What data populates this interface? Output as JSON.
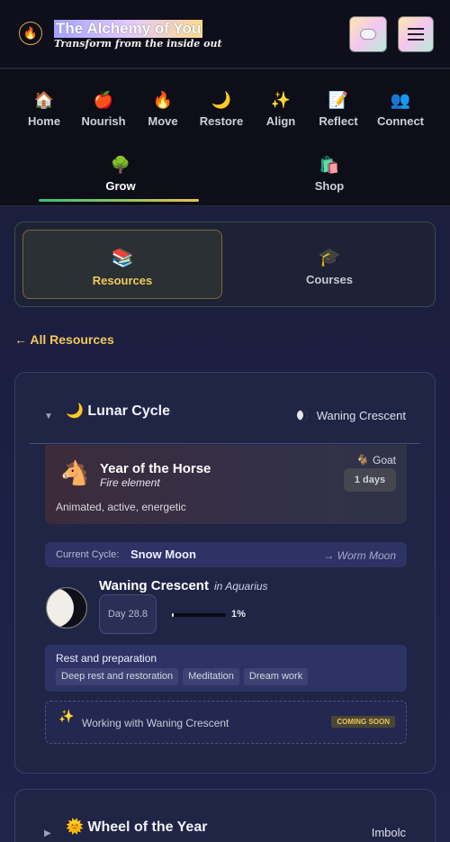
{
  "header": {
    "logo_icon": "flame-in-circle-icon",
    "brand_title": "The Alchemy of You",
    "brand_tagline": "Transform from the inside out",
    "chat_button_icon": "chat-bubble-icon",
    "menu_button_icon": "hamburger-menu-icon"
  },
  "nav": {
    "items": [
      {
        "label": "Home",
        "icon": "🏠"
      },
      {
        "label": "Nourish",
        "icon": "🍎"
      },
      {
        "label": "Move",
        "icon": "🔥"
      },
      {
        "label": "Restore",
        "icon": "🌙"
      },
      {
        "label": "Align",
        "icon": "✨"
      },
      {
        "label": "Reflect",
        "icon": "📝"
      },
      {
        "label": "Connect",
        "icon": "👥"
      },
      {
        "label": "Grow",
        "icon": "🌳"
      },
      {
        "label": "Shop",
        "icon": "🛍️"
      }
    ],
    "active": "Grow"
  },
  "subtabs": {
    "resources": {
      "label": "Resources",
      "icon": "📚"
    },
    "courses": {
      "label": "Courses",
      "icon": "🎓"
    },
    "active": "Resources"
  },
  "back_link": "← All Resources",
  "lunar": {
    "title": "Lunar Cycle",
    "title_icon": "🌙",
    "phase_name": "Waning Crescent",
    "zodiac": {
      "icon": "🐴",
      "year_title": "Year of the Horse",
      "element": "Fire element",
      "description": "Animated, active, energetic",
      "next_sign_icon": "🐐",
      "next_sign": "Goat",
      "days": "1 days"
    },
    "cycle": {
      "label": "Current Cycle:",
      "value": "Snow Moon",
      "next": "→ Worm Moon"
    },
    "phase": {
      "name": "Waning Crescent",
      "sign": "in Aquarius",
      "day": "Day 28.8",
      "progress": 0.01,
      "progress_label": "1%"
    },
    "focus": {
      "title": "Rest and preparation",
      "chips": [
        "Deep rest and restoration",
        "Meditation",
        "Dream work"
      ]
    },
    "working": {
      "icon": "✨",
      "text": "Working with Waning Crescent",
      "badge": "COMING SOON"
    }
  },
  "wheel": {
    "icon": "🌞",
    "title": "Wheel of the Year",
    "phase": "Imbolc"
  },
  "colors": {
    "accent_gold": "#f0c95a",
    "bg": "#1b1d3a",
    "card": "#202445"
  }
}
